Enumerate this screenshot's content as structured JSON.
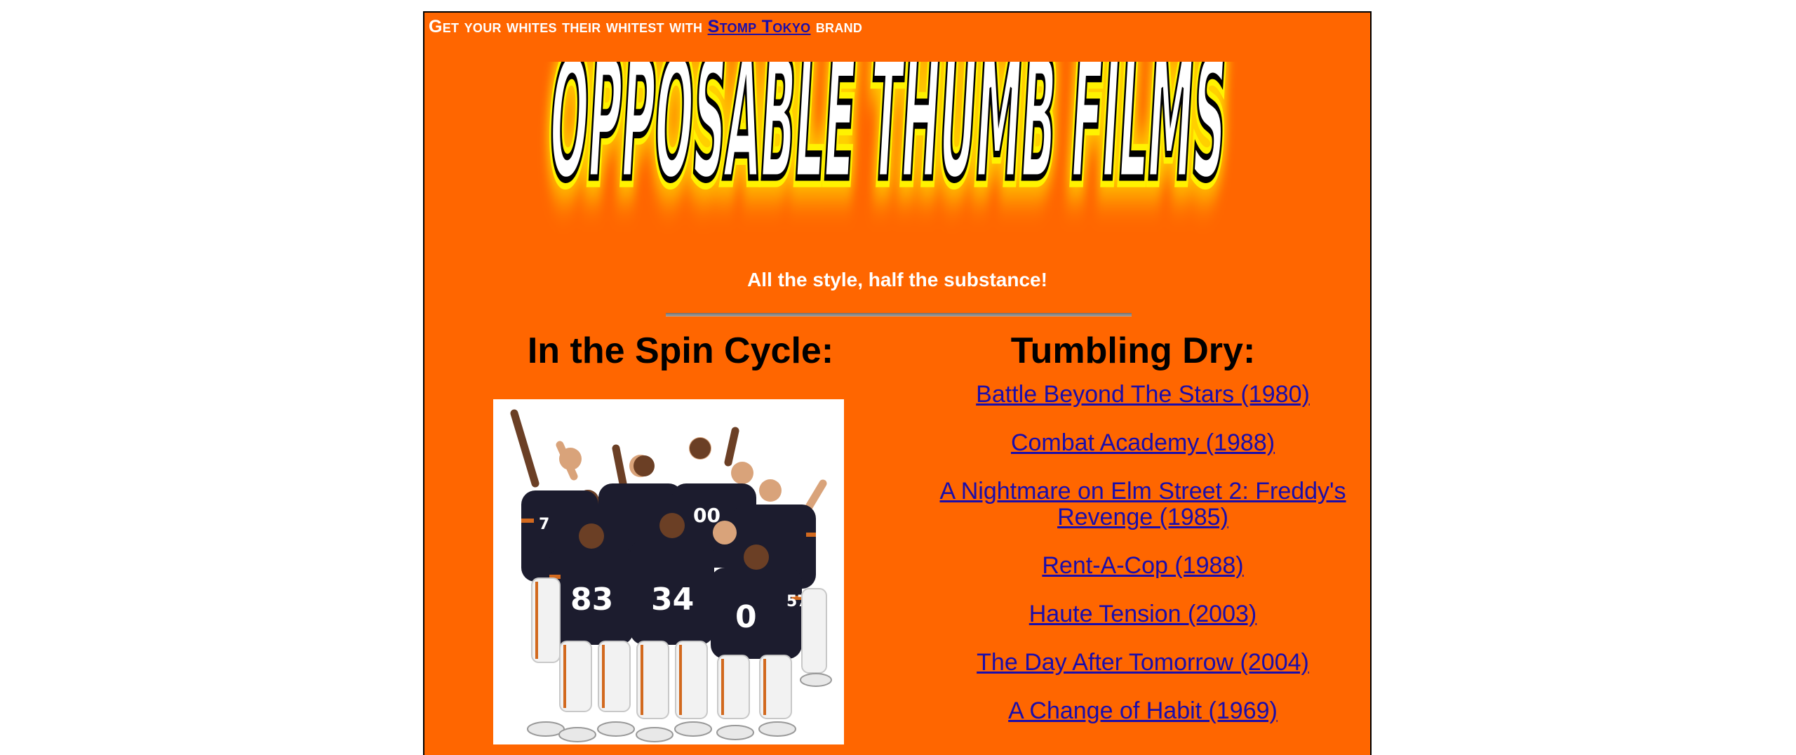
{
  "promo": {
    "prefix": "Get your whites their whitest with",
    "brand_link": "Stomp Tokyo",
    "suffix": "brand"
  },
  "logo": {
    "text": "OPPOSABLE THUMB FILMS"
  },
  "tagline": "All the style, half the substance!",
  "spin_cycle": {
    "heading": "In the Spin Cycle:"
  },
  "tumbling_dry": {
    "heading": "Tumbling Dry:",
    "films": [
      "Battle Beyond The Stars (1980)",
      "Combat Academy (1988)",
      "A Nightmare on Elm Street 2: Freddy's Revenge (1985)",
      "Rent-A-Cop (1988)",
      "Haute Tension (2003)",
      "The Day After Tomorrow (2004)",
      "A Change of Habit (1969)"
    ]
  },
  "colors": {
    "page_background": "#ff6600",
    "link": "#1a0dab",
    "text_light": "#ffffff",
    "jersey": "#1c1c2e",
    "rule": "#8a8a8a"
  }
}
